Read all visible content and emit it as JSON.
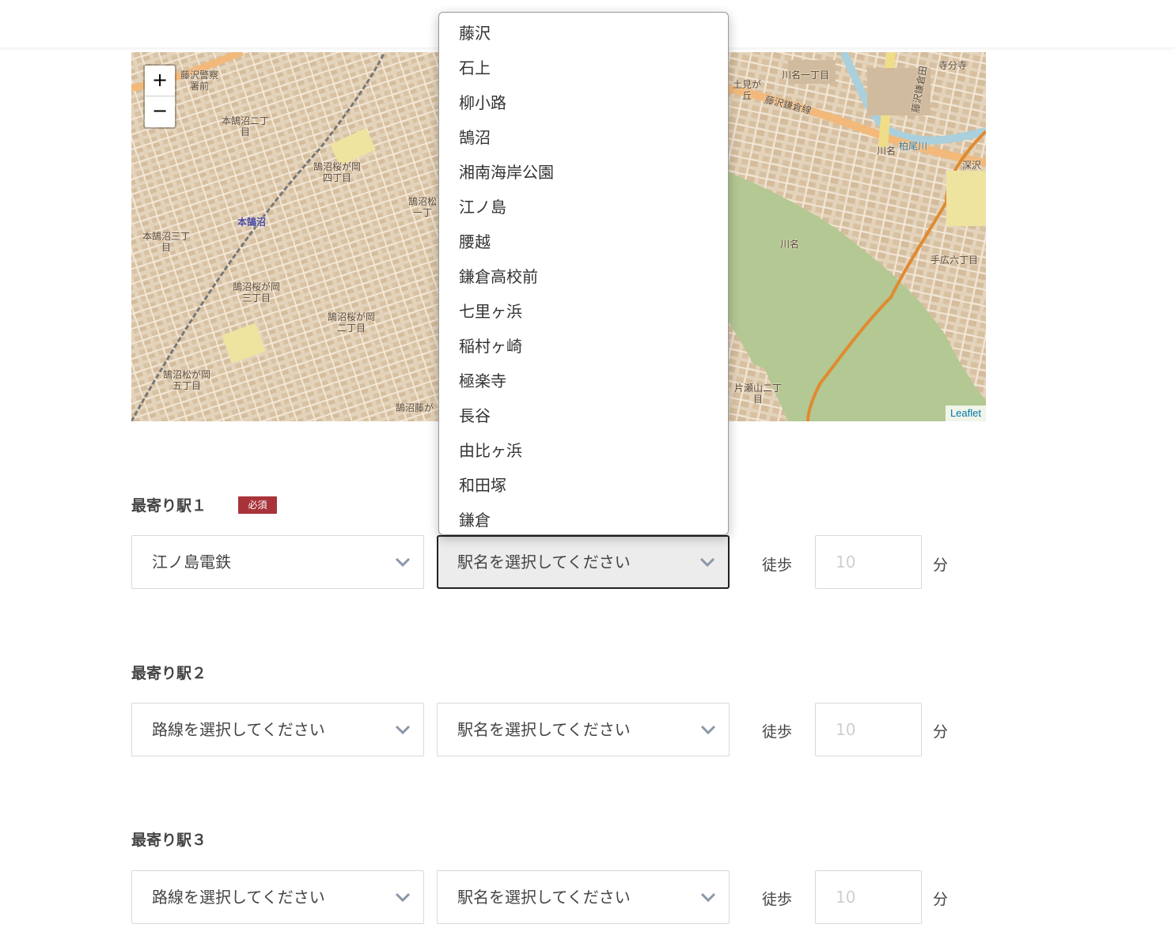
{
  "map": {
    "zoom_in": "+",
    "zoom_out": "−",
    "attribution": "Leaflet",
    "places": {
      "p1": "藤沢警察\n署前",
      "p2": "本鵠沼二丁\n目",
      "p3": "鵠沼桜が岡\n四丁目",
      "p4": "本鵠沼",
      "p5": "本鵠沼三丁\n目",
      "p6": "鵠沼桜が岡\n三丁目",
      "p7": "鵠沼桜が岡\n二丁目",
      "p8": "鵠沼松が岡\n五丁目",
      "p9": "鵠沼藤が",
      "p10": "鵠沼松\n一丁",
      "p11": "土見が\n丘",
      "p12": "川名一丁目",
      "p13": "藤沢鎌倉線",
      "p14": "川名",
      "p15": "柏尾川",
      "p16": "川名",
      "p17": "手広六丁目",
      "p18": "片瀬山二丁\n目",
      "p19": "深沢",
      "p20": "寺分寺",
      "p21": "藤沢鎌倉田"
    }
  },
  "station1": {
    "label": "最寄り駅１",
    "required_badge": "必須",
    "line_value": "江ノ島電鉄",
    "station_value": "駅名を選択してください",
    "walk_label": "徒歩",
    "minutes_placeholder": "10",
    "minutes_unit": "分"
  },
  "station2": {
    "label": "最寄り駅２",
    "line_value": "路線を選択してください",
    "station_value": "駅名を選択してください",
    "walk_label": "徒歩",
    "minutes_placeholder": "10",
    "minutes_unit": "分"
  },
  "station3": {
    "label": "最寄り駅３",
    "line_value": "路線を選択してください",
    "station_value": "駅名を選択してください",
    "walk_label": "徒歩",
    "minutes_placeholder": "10",
    "minutes_unit": "分"
  },
  "dropdown": {
    "options": [
      "藤沢",
      "石上",
      "柳小路",
      "鵠沼",
      "湘南海岸公園",
      "江ノ島",
      "腰越",
      "鎌倉高校前",
      "七里ヶ浜",
      "稲村ヶ崎",
      "極楽寺",
      "長谷",
      "由比ヶ浜",
      "和田塚",
      "鎌倉"
    ]
  },
  "colors": {
    "badge": "#a8343a",
    "map_urban": "#e6d6c0",
    "map_park": "#b5c994",
    "map_road_major": "#f2b97a",
    "map_railway": "#e08a30",
    "focus_border": "#222222",
    "link": "#0078a8"
  },
  "icons": [
    "plus-icon",
    "minus-icon",
    "chevron-down-icon"
  ]
}
